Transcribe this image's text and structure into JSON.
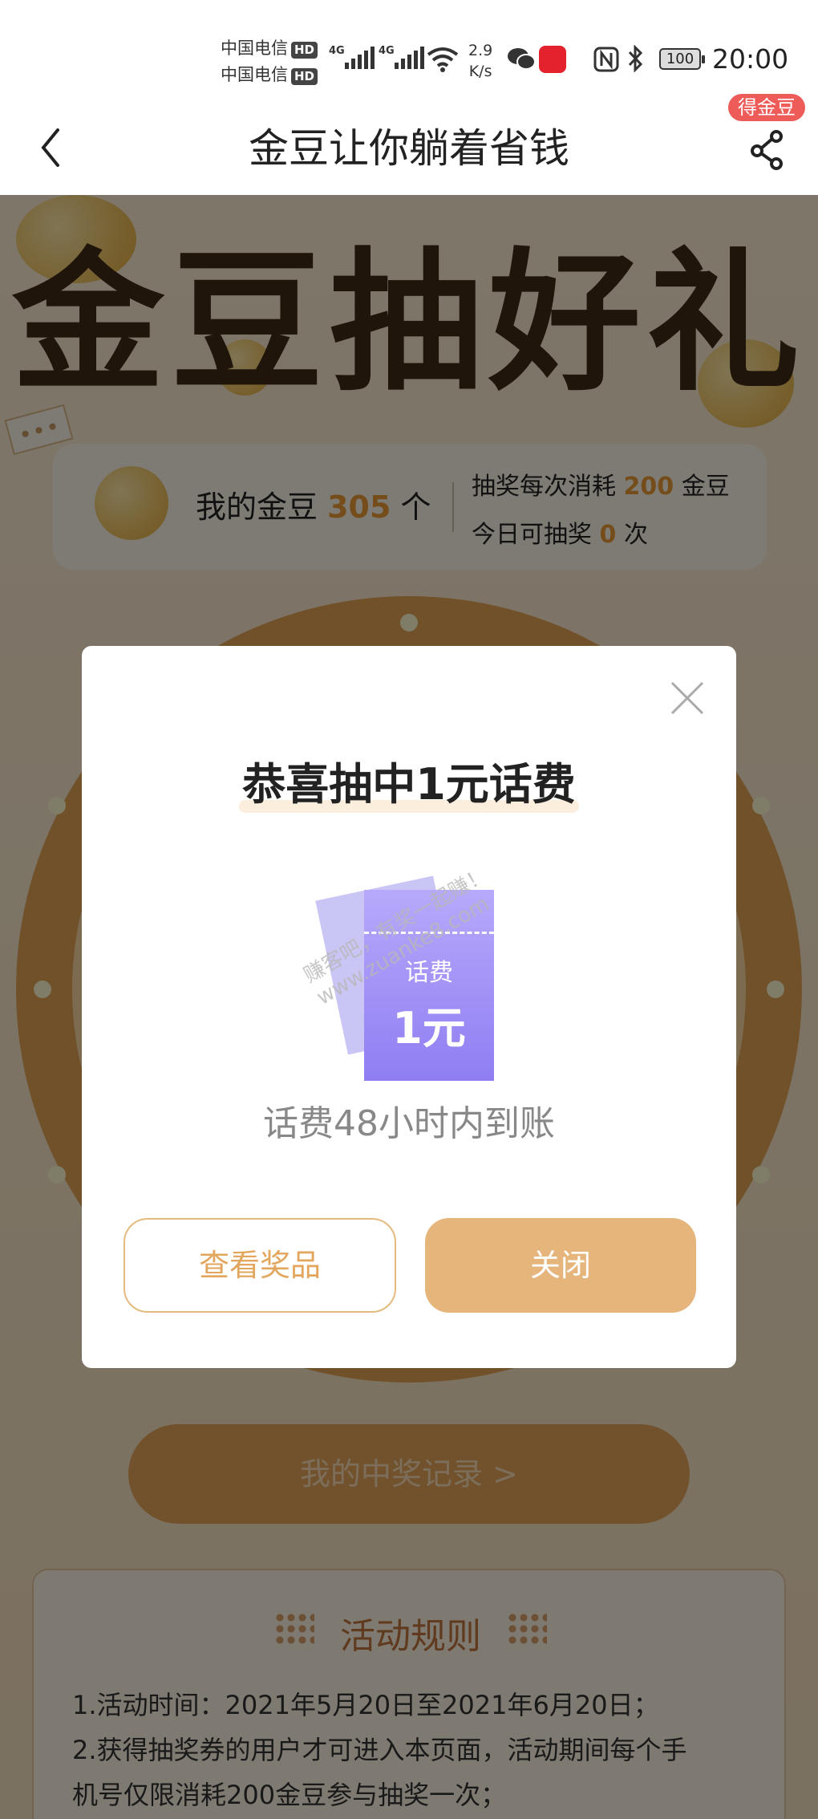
{
  "status_bar": {
    "carrier_1": "中国电信",
    "carrier_2": "中国电信",
    "hd_label": "HD",
    "network_label": "4G",
    "speed_value": "2.9",
    "speed_unit": "K/s",
    "battery": "100",
    "time": "20:00"
  },
  "nav": {
    "title": "金豆让你躺着省钱",
    "badge": "得金豆"
  },
  "hero": {
    "title": "金豆抽好礼"
  },
  "info_card": {
    "my_beans_prefix": "我的金豆",
    "my_beans_count": "305",
    "my_beans_suffix": "个",
    "cost_prefix": "抽奖每次消耗",
    "cost_value": "200",
    "cost_suffix": "金豆",
    "today_prefix": "今日可抽奖",
    "today_value": "0",
    "today_suffix": "次"
  },
  "record_button": "我的中奖记录 >",
  "rules": {
    "title": "活动规则",
    "line_1": "1.活动时间：2021年5月20日至2021年6月20日；",
    "line_2": "2.获得抽奖券的用户才可进入本页面，活动期间每个手",
    "line_3": "机号仅限消耗200金豆参与抽奖一次；"
  },
  "modal": {
    "title": "恭喜抽中1元话费",
    "coupon_label": "话费",
    "coupon_value": "1元",
    "note": "话费48小时内到账",
    "view_button": "查看奖品",
    "close_button": "关闭"
  },
  "watermark": {
    "line_1": "赚客吧，有奖一起赚！",
    "line_2": "www.zuanke8.com"
  },
  "colors": {
    "accent": "#e5b57c",
    "highlight_number": "#e99a35",
    "badge_red": "#ee5c5a",
    "coupon_purple": "#8f7ef2"
  },
  "icons": [
    "back-arrow-icon",
    "share-icon",
    "close-icon",
    "signal-icon",
    "wifi-icon",
    "wechat-icon",
    "nfc-icon",
    "bluetooth-icon",
    "battery-icon"
  ]
}
